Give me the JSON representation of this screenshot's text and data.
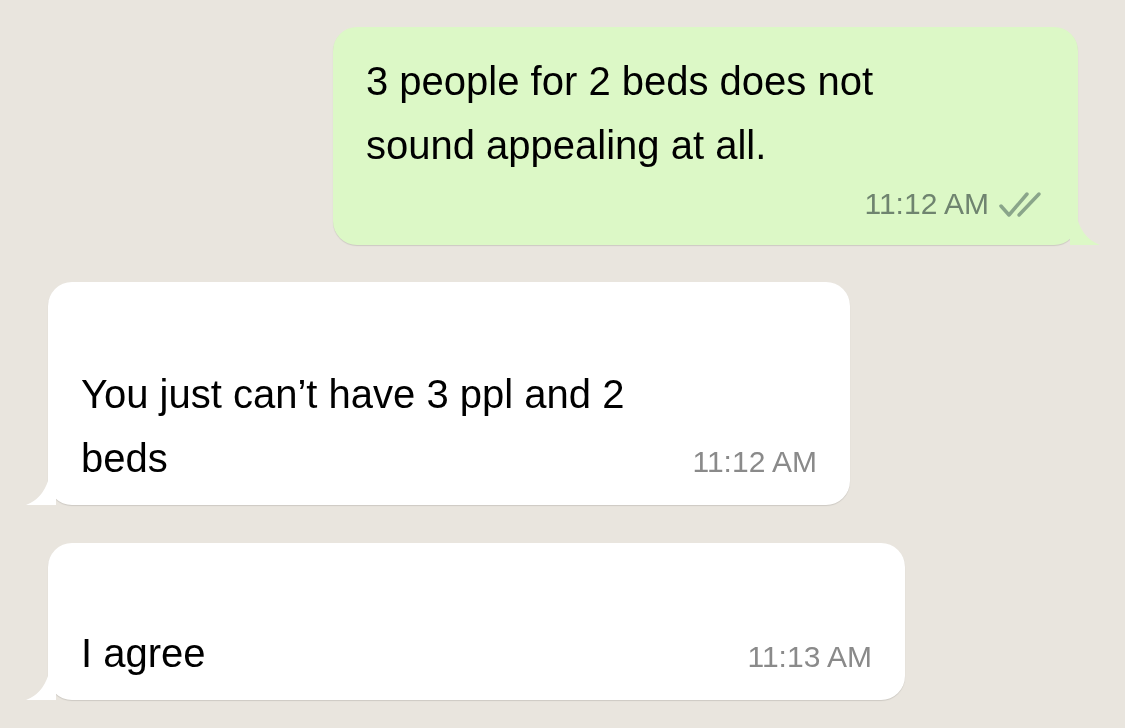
{
  "messages": [
    {
      "kind": "outgoing",
      "text": "3 people for 2 beds does not sound appealing at all.",
      "time": "11:12 AM",
      "read": false
    },
    {
      "kind": "incoming",
      "text": "You just can’t have 3 ppl and 2 beds",
      "time": "11:12 AM"
    },
    {
      "kind": "incoming",
      "text": "I agree",
      "time": "11:13 AM"
    }
  ]
}
